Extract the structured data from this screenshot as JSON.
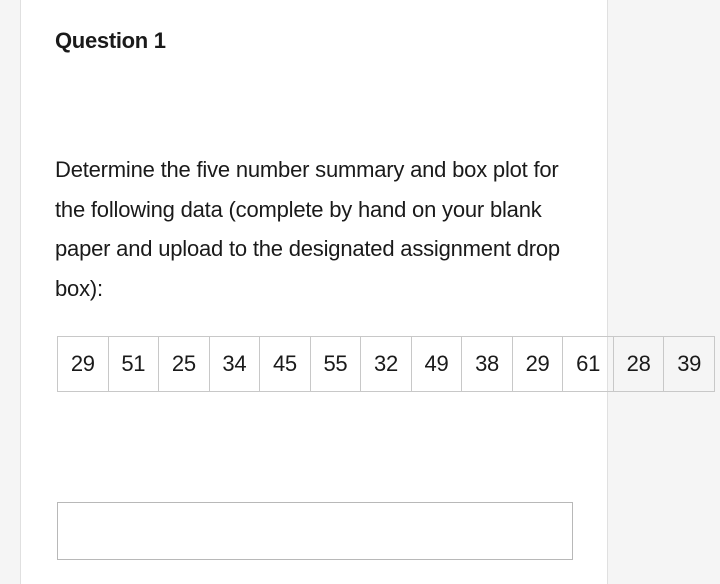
{
  "question": {
    "title": "Question 1",
    "prompt": "Determine the five number summary and  box plot for the following data (complete by hand on your blank paper and upload to the designated assignment drop box):",
    "data_values": [
      "29",
      "51",
      "25",
      "34",
      "45",
      "55",
      "32",
      "49",
      "38",
      "29",
      "61",
      "28",
      "39"
    ]
  }
}
